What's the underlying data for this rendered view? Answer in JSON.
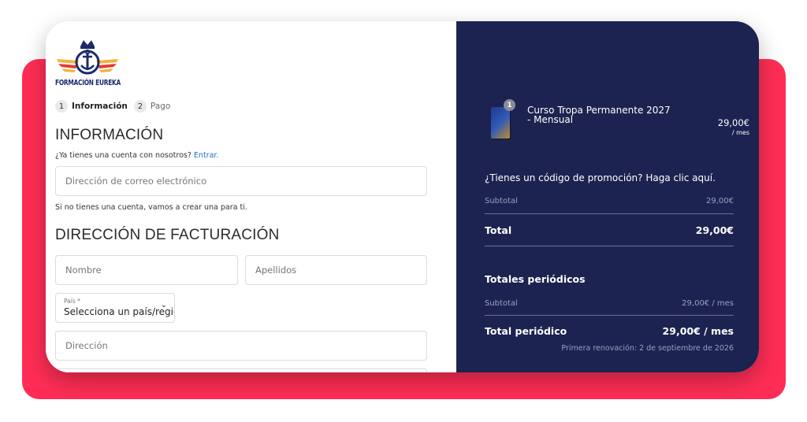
{
  "brand": {
    "name": "FORMACIÓN EUREKA"
  },
  "steps": [
    {
      "number": "1",
      "label": "Información"
    },
    {
      "number": "2",
      "label": "Pago"
    }
  ],
  "info_section": {
    "heading": "INFORMACIÓN",
    "account_prompt": "¿Ya tienes una cuenta con nosotros?",
    "login_link": "Entrar.",
    "email_placeholder": "Dirección de correo electrónico",
    "no_account_note": "Si no tienes una cuenta, vamos a crear una para ti."
  },
  "billing_section": {
    "heading": "DIRECCIÓN DE FACTURACIÓN",
    "first_name_placeholder": "Nombre",
    "last_name_placeholder": "Apellidos",
    "country_label": "País *",
    "country_value": "Selecciona un país/regió",
    "address_placeholder": "Dirección"
  },
  "order": {
    "product": {
      "quantity": "1",
      "name": "Curso Tropa Permanente 2027 - Mensual",
      "price": "29,00€",
      "period": "/ mes"
    },
    "promo_text": "¿Tienes un código de promoción? Haga clic aquí.",
    "subtotal_label": "Subtotal",
    "subtotal_value": "29,00€",
    "total_label": "Total",
    "total_value": "29,00€",
    "recurring_title": "Totales periódicos",
    "recurring_subtotal_label": "Subtotal",
    "recurring_subtotal_value": "29,00€ / mes",
    "recurring_total_label": "Total periódico",
    "recurring_total_value": "29,00€ / mes",
    "renewal_note": "Primera renovación: 2 de septiembre de 2026"
  },
  "colors": {
    "backdrop": "#ff2d55",
    "summary_panel": "#1c2350",
    "link": "#1e6fc9"
  }
}
